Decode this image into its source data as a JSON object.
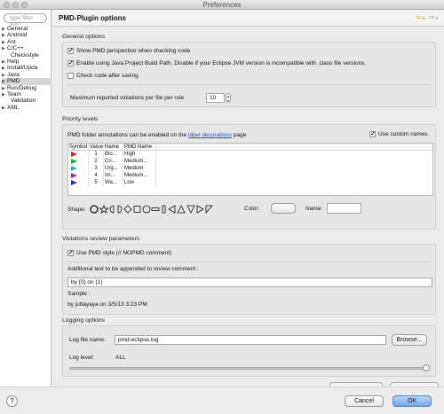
{
  "window": {
    "title": "Preferences"
  },
  "sidebar": {
    "filter_placeholder": "type filter text",
    "items": [
      {
        "label": "General",
        "arrow": "▶"
      },
      {
        "label": "Android",
        "arrow": "▶"
      },
      {
        "label": "Ant",
        "arrow": "▶"
      },
      {
        "label": "C/C++",
        "arrow": "▶"
      },
      {
        "label": "Checkstyle",
        "arrow": ""
      },
      {
        "label": "Help",
        "arrow": "▶"
      },
      {
        "label": "Install/Upda",
        "arrow": "▶"
      },
      {
        "label": "Java",
        "arrow": "▶"
      },
      {
        "label": "PMD",
        "arrow": "▶"
      },
      {
        "label": "Run/Debug",
        "arrow": "▶"
      },
      {
        "label": "Team",
        "arrow": "▶"
      },
      {
        "label": "Validation",
        "arrow": ""
      },
      {
        "label": "XML",
        "arrow": "▶"
      }
    ],
    "selected": "PMD"
  },
  "header": {
    "title": "PMD-Plugin options",
    "nav": "⇦ ▾  ⇨ ▾"
  },
  "general": {
    "title": "General options",
    "show_perspective": {
      "label": "Show PMD perspective when checking code",
      "checked": true
    },
    "build_path": {
      "label": "Enable using Java Project Build Path.  Disable if your Eclipse JVM version is incompatible with .class file versions.",
      "checked": true
    },
    "check_after_saving": {
      "label": "Check code after saving",
      "checked": false
    },
    "max_violations_label": "Maximum reported violations per file per rule",
    "max_violations_value": "10"
  },
  "priority": {
    "title": "Priority levels",
    "annotations_text_before": "PMD folder annotations can be enabled on the",
    "annotations_link": "label decorations",
    "annotations_text_after": "page",
    "use_custom_names": {
      "label": "Use custom names",
      "checked": true
    },
    "columns": [
      "Symbol",
      "Value",
      "Name",
      "PMD Name"
    ],
    "rows": [
      {
        "color": "#d82020",
        "value": "1",
        "name": "Blo...",
        "pmd_name": "High"
      },
      {
        "color": "#20b040",
        "value": "2",
        "name": "Cri...",
        "pmd_name": "Medium..."
      },
      {
        "color": "#20b8d0",
        "value": "3",
        "name": "Urg...",
        "pmd_name": "Medium"
      },
      {
        "color": "#b020b0",
        "value": "4",
        "name": "Im...",
        "pmd_name": "Medium..."
      },
      {
        "color": "#2030c8",
        "value": "5",
        "name": "Wa...",
        "pmd_name": "Low"
      }
    ],
    "shape_label": "Shape:",
    "color_label": "Color:",
    "name_label": "Name:"
  },
  "violations": {
    "title": "Violations review parameters",
    "use_pmd_style": {
      "label": "Use PMD style (// NOPMD comment)",
      "checked": true
    },
    "additional_text_label": "Additional text to be appended to review comment :",
    "additional_text_value": "by {0} on {1}",
    "sample_label": "Sample :",
    "sample_value": "by juttayaya on 3/5/13 3:23 PM"
  },
  "logging": {
    "title": "Logging options",
    "file_label": "Log file name:",
    "file_value": "pmd-eclipse.log",
    "browse_label": "Browse...",
    "level_label": "Log level:",
    "level_value": "ALL",
    "level_fraction": 1.0
  },
  "footer": {
    "help_symbol": "?",
    "cancel_label": "Cancel",
    "ok_label": "OK"
  }
}
